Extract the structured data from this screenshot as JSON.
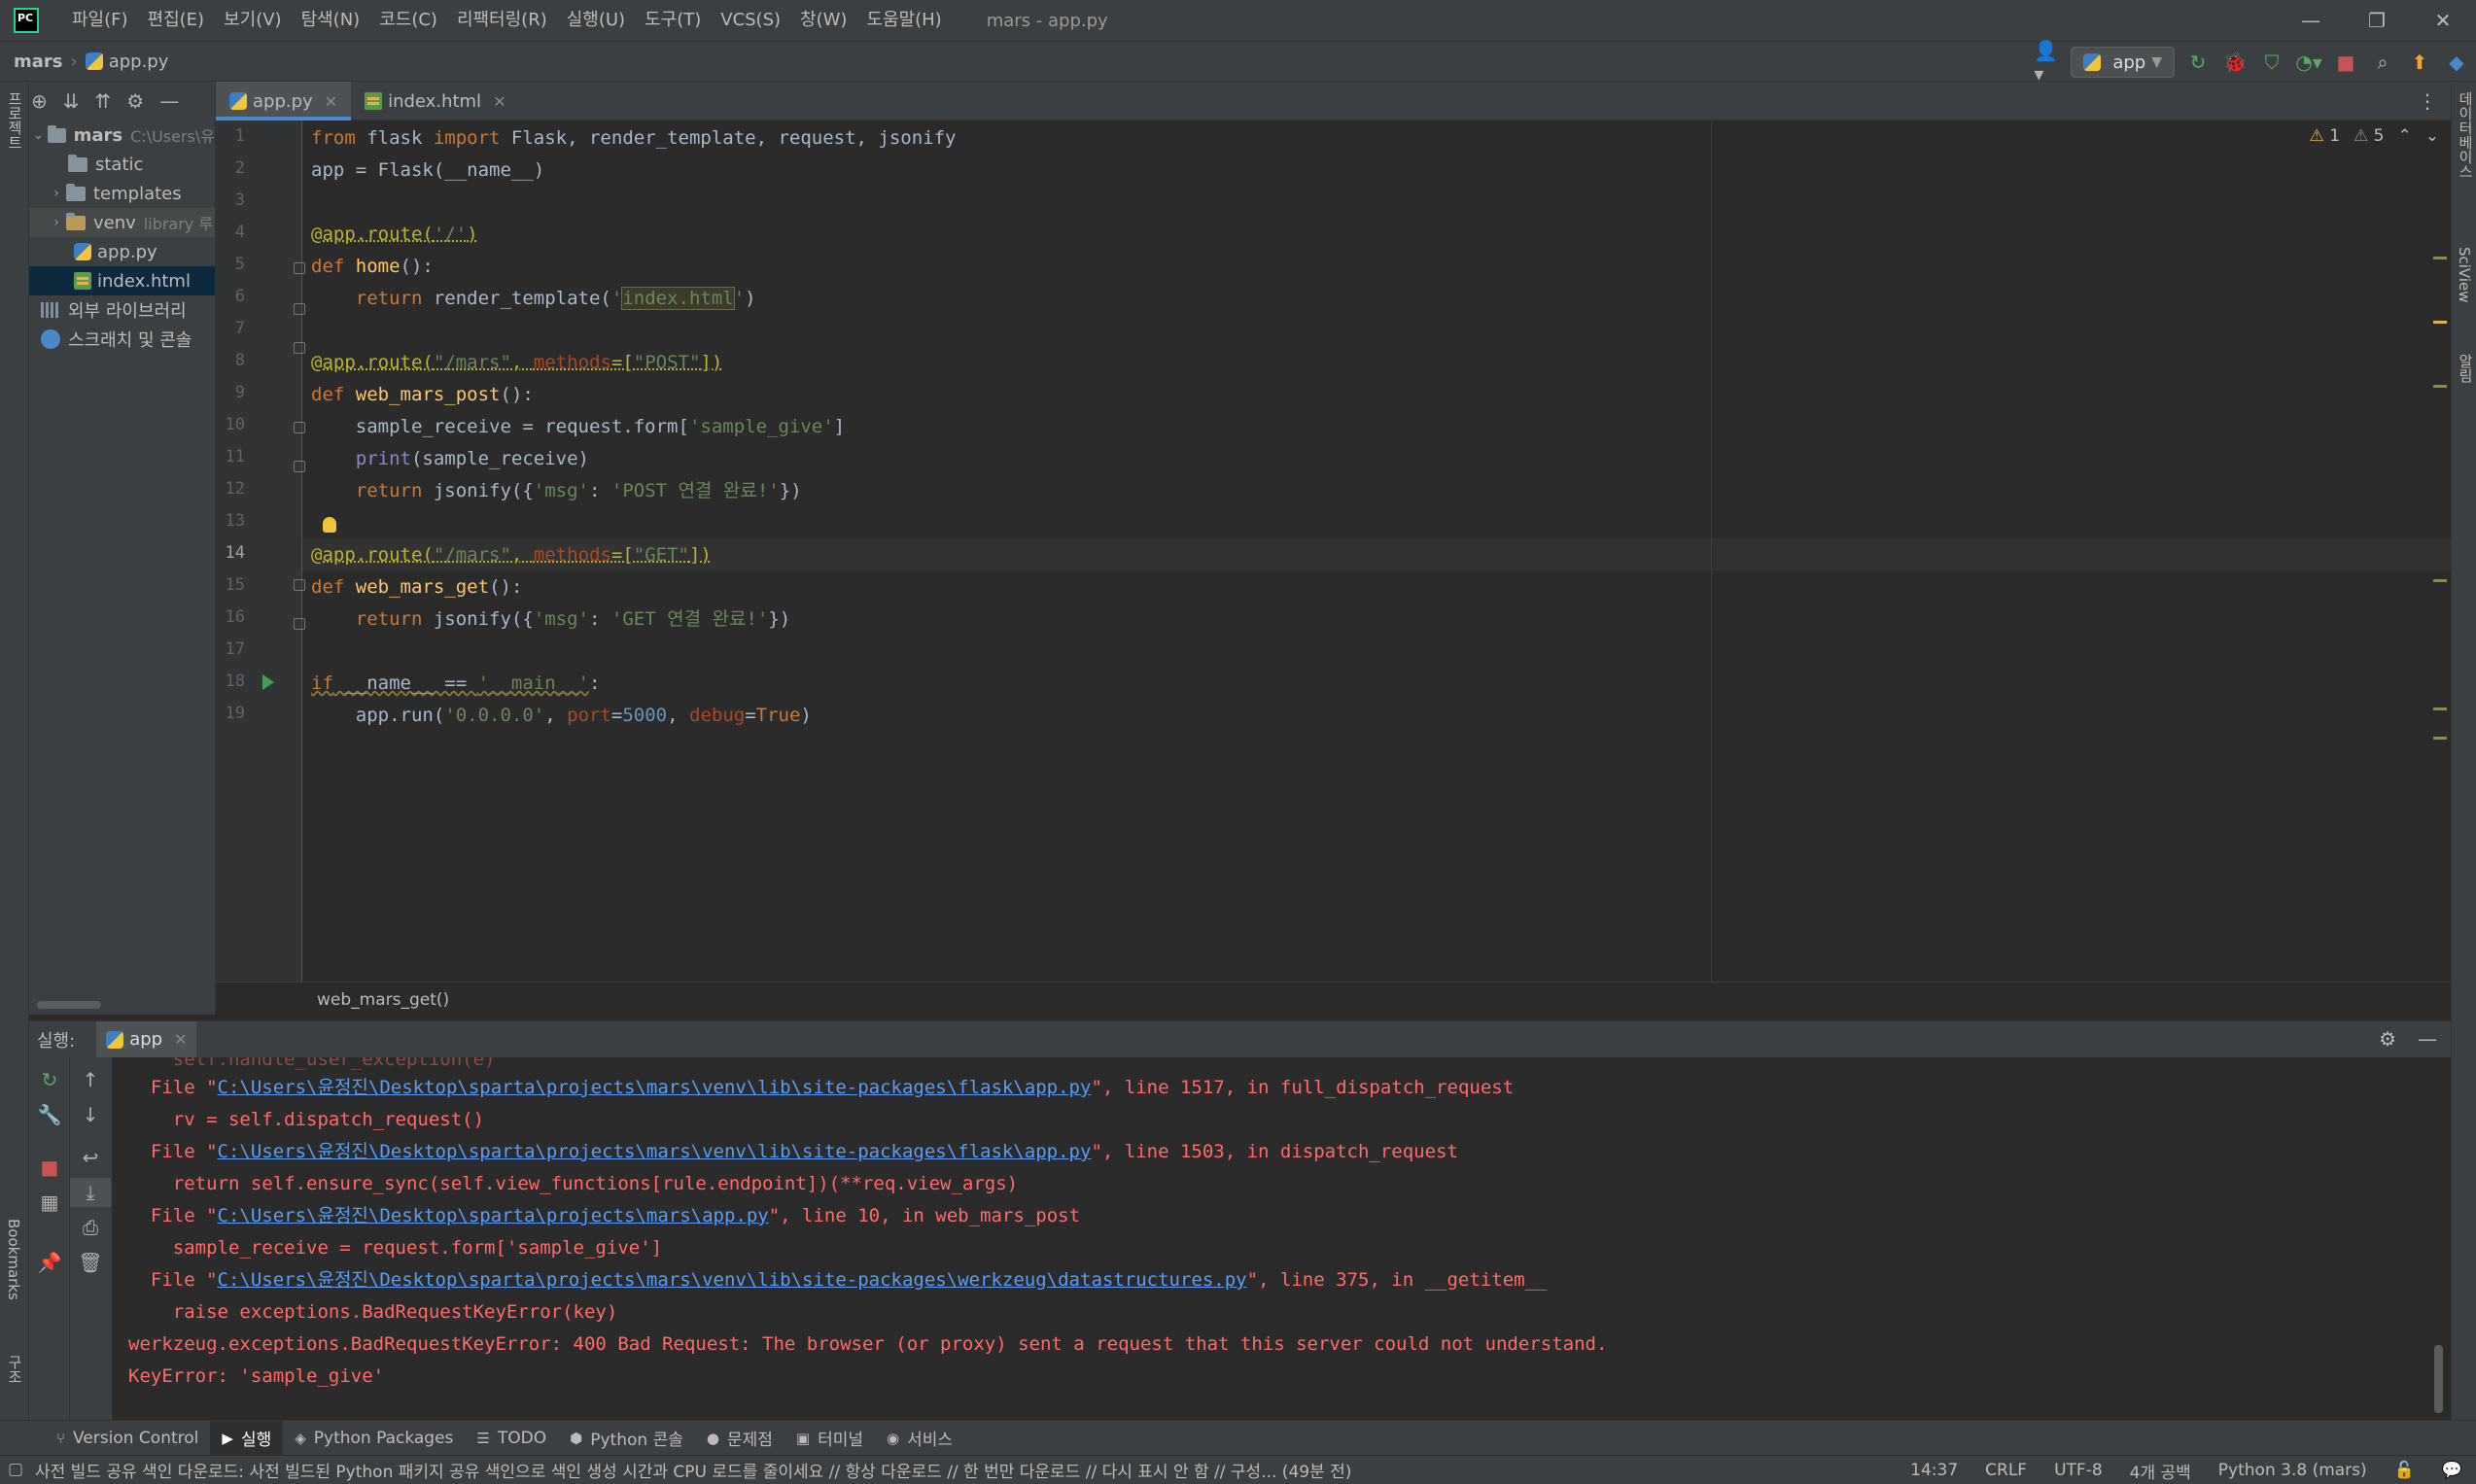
{
  "app": {
    "logo_text": "PC",
    "window_title": "mars - app.py"
  },
  "menu": [
    "파일(F)",
    "편집(E)",
    "보기(V)",
    "탐색(N)",
    "코드(C)",
    "리팩터링(R)",
    "실행(U)",
    "도구(T)",
    "VCS(S)",
    "창(W)",
    "도움말(H)"
  ],
  "window_controls": {
    "minimize": "—",
    "restore": "❐",
    "close": "✕"
  },
  "breadcrumb": {
    "project": "mars",
    "file": "app.py"
  },
  "run_config": {
    "label": "app"
  },
  "left_strip": {
    "project_label": "프로젝트",
    "bookmarks_label": "Bookmarks",
    "structure_label": "구조"
  },
  "right_strip": {
    "database_label": "데이터베이스",
    "sciview_label": "SciView",
    "notifications_label": "알림"
  },
  "project_tree": {
    "root": {
      "name": "mars",
      "path": "C:\\Users\\유"
    },
    "items": [
      {
        "name": "static",
        "type": "folder"
      },
      {
        "name": "templates",
        "type": "folder"
      },
      {
        "name": "venv",
        "type": "folder",
        "note": "library 루"
      },
      {
        "name": "app.py",
        "type": "py"
      },
      {
        "name": "index.html",
        "type": "html"
      }
    ],
    "external_libs": "외부 라이브러리",
    "scratches": "스크래치 및 콘솔"
  },
  "tabs": [
    {
      "label": "app.py",
      "active": true
    },
    {
      "label": "index.html",
      "active": false
    }
  ],
  "inspection": {
    "warnings": "1",
    "weak_warnings": "5"
  },
  "editor": {
    "line_numbers": [
      "1",
      "2",
      "3",
      "4",
      "5",
      "6",
      "7",
      "8",
      "9",
      "10",
      "11",
      "12",
      "13",
      "14",
      "15",
      "16",
      "17",
      "18",
      "19"
    ],
    "current_line": 14
  },
  "breadcrumb_function": "web_mars_get()",
  "run_panel": {
    "label": "실행:",
    "tab_label": "app"
  },
  "console": {
    "lines": [
      {
        "pre": "  File \"",
        "link": "C:\\Users\\윤정진\\Desktop\\sparta\\projects\\mars\\venv\\lib\\site-packages\\flask\\app.py",
        "post": "\", line 1517, in full_dispatch_request"
      },
      {
        "text": "    rv = self.dispatch_request()"
      },
      {
        "pre": "  File \"",
        "link": "C:\\Users\\윤정진\\Desktop\\sparta\\projects\\mars\\venv\\lib\\site-packages\\flask\\app.py",
        "post": "\", line 1503, in dispatch_request"
      },
      {
        "text": "    return self.ensure_sync(self.view_functions[rule.endpoint])(**req.view_args)"
      },
      {
        "pre": "  File \"",
        "link": "C:\\Users\\윤정진\\Desktop\\sparta\\projects\\mars\\app.py",
        "post": "\", line 10, in web_mars_post"
      },
      {
        "text": "    sample_receive = request.form['sample_give']"
      },
      {
        "pre": "  File \"",
        "link": "C:\\Users\\윤정진\\Desktop\\sparta\\projects\\mars\\venv\\lib\\site-packages\\werkzeug\\datastructures.py",
        "post": "\", line 375, in __getitem__"
      },
      {
        "text": "    raise exceptions.BadRequestKeyError(key)"
      },
      {
        "text": "werkzeug.exceptions.BadRequestKeyError: 400 Bad Request: The browser (or proxy) sent a request that this server could not understand."
      },
      {
        "text": "KeyError: 'sample_give'"
      }
    ]
  },
  "tool_windows": [
    {
      "label": "Version Control",
      "icon": "⑂",
      "active": false
    },
    {
      "label": "실행",
      "icon": "▶",
      "active": true
    },
    {
      "label": "Python Packages",
      "icon": "◈",
      "active": false
    },
    {
      "label": "TODO",
      "icon": "☰",
      "active": false
    },
    {
      "label": "Python 콘솔",
      "icon": "⬢",
      "active": false
    },
    {
      "label": "문제점",
      "icon": "●",
      "active": false
    },
    {
      "label": "터미널",
      "icon": "▣",
      "active": false
    },
    {
      "label": "서비스",
      "icon": "◉",
      "active": false
    }
  ],
  "status": {
    "message": "사전 빌드 공유 색인 다운로드: 사전 빌드된 Python 패키지 공유 색인으로 색인 생성 시간과 CPU 로드를 줄이세요 // 항상 다운로드 // 한 번만 다운로드 // 다시 표시 안 함 // 구성... (49분 전)",
    "position": "14:37",
    "line_sep": "CRLF",
    "encoding": "UTF-8",
    "indent": "4개 공백",
    "interpreter": "Python 3.8 (mars)"
  },
  "colors": {
    "accent": "#4a88c7",
    "error": "#ff6b68",
    "link": "#589df6",
    "warning": "#e8b04a",
    "run_green": "#499c54"
  }
}
